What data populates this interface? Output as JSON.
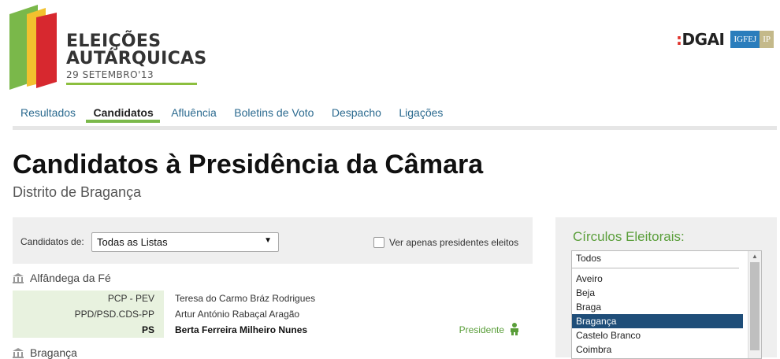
{
  "branding": {
    "title_line1": "ELEIÇÕES",
    "title_line2": "AUTÁRQUICAS",
    "date": "29 SETEMBRO'13",
    "partner1": "DGAI",
    "partner2_a": "IGFEJ",
    "partner2_b": "IP"
  },
  "nav": {
    "items": [
      {
        "label": "Resultados"
      },
      {
        "label": "Candidatos"
      },
      {
        "label": "Afluência"
      },
      {
        "label": "Boletins de Voto"
      },
      {
        "label": "Despacho"
      },
      {
        "label": "Ligações"
      }
    ],
    "active": "Candidatos"
  },
  "page": {
    "title": "Candidatos à Presidência da Câmara",
    "subtitle": "Distrito de Bragança"
  },
  "filter": {
    "label": "Candidatos de:",
    "selected": "Todas as Listas",
    "checkbox_label": "Ver apenas presidentes eleitos",
    "checkbox_checked": false
  },
  "municipalities": [
    {
      "name": "Alfândega da Fé",
      "candidates": [
        {
          "party": "PCP - PEV",
          "name": "Teresa do Carmo Bráz Rodrigues",
          "role": ""
        },
        {
          "party": "PPD/PSD.CDS-PP",
          "name": "Artur António Rabaçal Aragão",
          "role": ""
        },
        {
          "party": "PS",
          "name": "Berta Ferreira Milheiro Nunes",
          "role": "Presidente"
        }
      ]
    },
    {
      "name": "Bragança",
      "candidates": []
    }
  ],
  "sidebar": {
    "title": "Círculos Eleitorais:",
    "options": [
      "Todos",
      "Aveiro",
      "Beja",
      "Braga",
      "Bragança",
      "Castelo Branco",
      "Coimbra"
    ],
    "selected": "Bragança"
  },
  "colors": {
    "accent_green": "#5a9e3a",
    "nav_link": "#2b6a8f",
    "selected_bg": "#1f4e79",
    "party_bg": "#e8f2df"
  }
}
